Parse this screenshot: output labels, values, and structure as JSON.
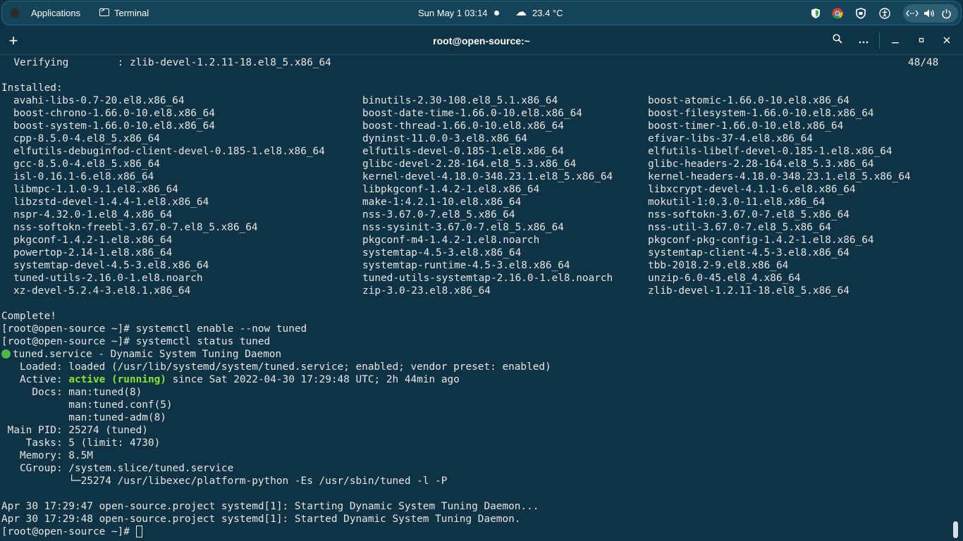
{
  "topbar": {
    "applications": "Applications",
    "terminal": "Terminal",
    "date": "Sun May 1",
    "time": "03:14",
    "weather": "23.4 °C"
  },
  "window": {
    "title": "root@open-source:~"
  },
  "terminal": {
    "verifying_label": "  Verifying        : zlib-devel-1.2.11-18.el8_5.x86_64",
    "verifying_count": "48/48",
    "installed_header": "Installed:",
    "packages": [
      [
        "avahi-libs-0.7-20.el8.x86_64",
        "binutils-2.30-108.el8_5.1.x86_64",
        "boost-atomic-1.66.0-10.el8.x86_64"
      ],
      [
        "boost-chrono-1.66.0-10.el8.x86_64",
        "boost-date-time-1.66.0-10.el8.x86_64",
        "boost-filesystem-1.66.0-10.el8.x86_64"
      ],
      [
        "boost-system-1.66.0-10.el8.x86_64",
        "boost-thread-1.66.0-10.el8.x86_64",
        "boost-timer-1.66.0-10.el8.x86_64"
      ],
      [
        "cpp-8.5.0-4.el8_5.x86_64",
        "dyninst-11.0.0-3.el8.x86_64",
        "efivar-libs-37-4.el8.x86_64"
      ],
      [
        "elfutils-debuginfod-client-devel-0.185-1.el8.x86_64",
        "elfutils-devel-0.185-1.el8.x86_64",
        "elfutils-libelf-devel-0.185-1.el8.x86_64"
      ],
      [
        "gcc-8.5.0-4.el8_5.x86_64",
        "glibc-devel-2.28-164.el8_5.3.x86_64",
        "glibc-headers-2.28-164.el8_5.3.x86_64"
      ],
      [
        "isl-0.16.1-6.el8.x86_64",
        "kernel-devel-4.18.0-348.23.1.el8_5.x86_64",
        "kernel-headers-4.18.0-348.23.1.el8_5.x86_64"
      ],
      [
        "libmpc-1.1.0-9.1.el8.x86_64",
        "libpkgconf-1.4.2-1.el8.x86_64",
        "libxcrypt-devel-4.1.1-6.el8.x86_64"
      ],
      [
        "libzstd-devel-1.4.4-1.el8.x86_64",
        "make-1:4.2.1-10.el8.x86_64",
        "mokutil-1:0.3.0-11.el8.x86_64"
      ],
      [
        "nspr-4.32.0-1.el8_4.x86_64",
        "nss-3.67.0-7.el8_5.x86_64",
        "nss-softokn-3.67.0-7.el8_5.x86_64"
      ],
      [
        "nss-softokn-freebl-3.67.0-7.el8_5.x86_64",
        "nss-sysinit-3.67.0-7.el8_5.x86_64",
        "nss-util-3.67.0-7.el8_5.x86_64"
      ],
      [
        "pkgconf-1.4.2-1.el8.x86_64",
        "pkgconf-m4-1.4.2-1.el8.noarch",
        "pkgconf-pkg-config-1.4.2-1.el8.x86_64"
      ],
      [
        "powertop-2.14-1.el8.x86_64",
        "systemtap-4.5-3.el8.x86_64",
        "systemtap-client-4.5-3.el8.x86_64"
      ],
      [
        "systemtap-devel-4.5-3.el8.x86_64",
        "systemtap-runtime-4.5-3.el8.x86_64",
        "tbb-2018.2-9.el8.x86_64"
      ],
      [
        "tuned-utils-2.16.0-1.el8.noarch",
        "tuned-utils-systemtap-2.16.0-1.el8.noarch",
        "unzip-6.0-45.el8_4.x86_64"
      ],
      [
        "xz-devel-5.2.4-3.el8.1.x86_64",
        "zip-3.0-23.el8.x86_64",
        "zlib-devel-1.2.11-18.el8_5.x86_64"
      ]
    ],
    "complete": "Complete!",
    "cmd1": "[root@open-source ~]# systemctl enable --now tuned",
    "cmd2": "[root@open-source ~]# systemctl status tuned",
    "service_line": "tuned.service - Dynamic System Tuning Daemon",
    "loaded": "   Loaded: loaded (/usr/lib/systemd/system/tuned.service; enabled; vendor preset: enabled)",
    "active_prefix": "   Active: ",
    "active_state": "active (running)",
    "active_suffix": " since Sat 2022-04-30 17:29:48 UTC; 2h 44min ago",
    "docs1": "     Docs: man:tuned(8)",
    "docs2": "           man:tuned.conf(5)",
    "docs3": "           man:tuned-adm(8)",
    "main_pid": " Main PID: 25274 (tuned)",
    "tasks": "    Tasks: 5 (limit: 4730)",
    "memory": "   Memory: 8.5M",
    "cgroup": "   CGroup: /system.slice/tuned.service",
    "cgroup_child": "           └─25274 /usr/libexec/platform-python -Es /usr/sbin/tuned -l -P",
    "log1": "Apr 30 17:29:47 open-source.project systemd[1]: Starting Dynamic System Tuning Daemon...",
    "log2": "Apr 30 17:29:48 open-source.project systemd[1]: Started Dynamic System Tuning Daemon.",
    "prompt": "[root@open-source ~]# "
  }
}
